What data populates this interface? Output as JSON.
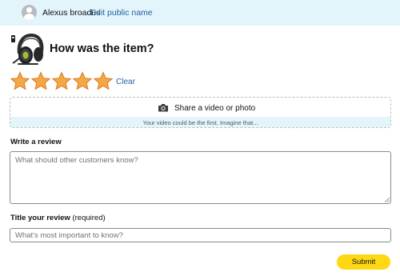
{
  "profile": {
    "name": "Alexus broadus",
    "edit_link": "Edit public name"
  },
  "product": {
    "question": "How was the item?",
    "image_icon": "gaming-headset-icon"
  },
  "rating": {
    "selected": 5,
    "max": 5,
    "star_color": "#f3a847",
    "clear_label": "Clear"
  },
  "media_upload": {
    "label": "Share a video or photo",
    "hint": "Your video could be the first. Imagine that...",
    "icon": "camera-icon"
  },
  "review": {
    "label": "Write a review",
    "placeholder": "What should other customers know?",
    "value": ""
  },
  "title": {
    "label": "Title your review",
    "required_note": "(required)",
    "placeholder": "What's most important to know?",
    "value": ""
  },
  "submit": {
    "label": "Submit",
    "color": "#ffd814"
  },
  "colors": {
    "link": "#2162a1",
    "banner_bg": "#e3f4fb"
  }
}
